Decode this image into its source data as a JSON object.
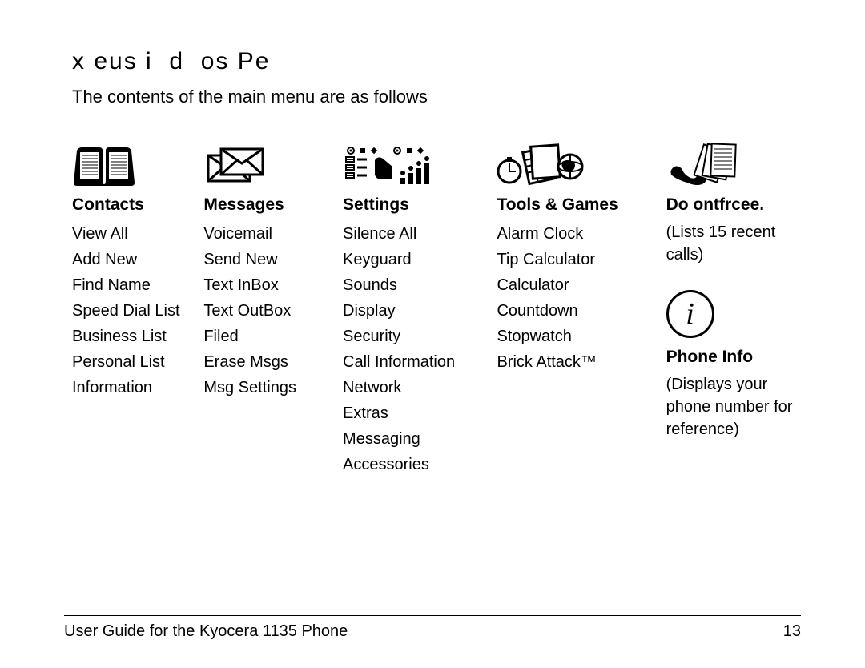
{
  "title_mangled": "x eus i  d  os Pe",
  "intro": "The contents of the main menu are as follows",
  "contacts": {
    "heading": "Contacts",
    "items": [
      "View All",
      "Add New",
      "Find Name",
      "Speed Dial List",
      "Business List",
      "Personal List",
      "Information"
    ]
  },
  "messages": {
    "heading": "Messages",
    "items": [
      "Voicemail",
      "Send New",
      "Text InBox",
      "Text OutBox",
      "Filed",
      "Erase Msgs",
      "Msg Settings"
    ]
  },
  "settings": {
    "heading": "Settings",
    "items": [
      "Silence All",
      "Keyguard",
      "Sounds",
      "Display",
      "Security",
      "Call Information",
      "Network",
      "Extras",
      "Messaging",
      "Accessories"
    ]
  },
  "tools": {
    "heading": "Tools & Games",
    "items": [
      "Alarm Clock",
      "Tip Calculator",
      "Calculator",
      "Countdown",
      "Stopwatch",
      "Brick Attack™"
    ]
  },
  "recent": {
    "heading": "Do ontfrcee.",
    "desc": "(Lists 15 recent calls)"
  },
  "phone_info": {
    "heading": "Phone Info",
    "desc": "(Displays your phone number for reference)"
  },
  "footer": {
    "left": "User Guide for the Kyocera 1135 Phone",
    "right": "13"
  }
}
